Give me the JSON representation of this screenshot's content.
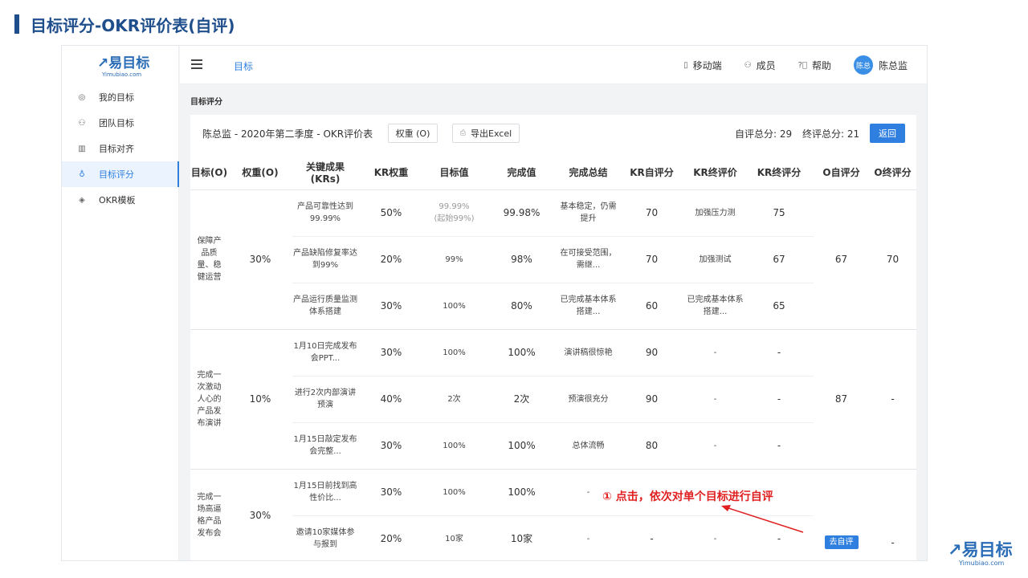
{
  "slide_title": "目标评分-OKR评价表(自评)",
  "logo": {
    "text": "易目标",
    "sub": "Yimubiao.com",
    "mark": "↗"
  },
  "sidebar": {
    "items": [
      {
        "label": "我的目标",
        "icon": "target-icon"
      },
      {
        "label": "团队目标",
        "icon": "team-icon"
      },
      {
        "label": "目标对齐",
        "icon": "book-icon"
      },
      {
        "label": "目标评分",
        "icon": "medal-icon",
        "active": true
      },
      {
        "label": "OKR模板",
        "icon": "layers-icon"
      }
    ]
  },
  "topbar": {
    "nav_label": "目标",
    "mobile": "移动端",
    "members": "成员",
    "help": "帮助",
    "avatar_text": "陈总",
    "user": "陈总监"
  },
  "section_label": "目标评分",
  "card": {
    "title": "陈总监 - 2020年第二季度 - OKR评价表",
    "weight_button": "权重 (O)",
    "export_button": "导出Excel",
    "self_total": "自评总分: 29",
    "final_total": "终评总分: 21",
    "back_button": "返回"
  },
  "table": {
    "headers": [
      "目标(O)",
      "权重(O)",
      "关键成果(KRs)",
      "KR权重",
      "目标值",
      "完成值",
      "完成总结",
      "KR自评分",
      "KR终评价",
      "KR终评分",
      "O自评分",
      "O终评分"
    ],
    "groups": [
      {
        "objective": "保障产品质量、稳健运营",
        "weight": "30%",
        "o_self": "67",
        "o_final": "70",
        "krs": [
          {
            "kr": "产品可靠性达到99.99%",
            "kr_weight": "50%",
            "target": "99.99%",
            "target_note": "(起始99%)",
            "done": "99.98%",
            "summary": "基本稳定，仍需提升",
            "self": "70",
            "final_eval": "加强压力测",
            "final_score": "75"
          },
          {
            "kr": "产品缺陷修复率达到99%",
            "kr_weight": "20%",
            "target": "99%",
            "target_note": "",
            "done": "98%",
            "summary": "在可接受范围，需继...",
            "self": "70",
            "final_eval": "加强测试",
            "final_score": "67"
          },
          {
            "kr": "产品运行质量监测体系搭建",
            "kr_weight": "30%",
            "target": "100%",
            "target_note": "",
            "done": "80%",
            "summary": "已完成基本体系搭建...",
            "self": "60",
            "final_eval": "已完成基本体系搭建...",
            "final_score": "65"
          }
        ]
      },
      {
        "objective": "完成一次激动人心的产品发布演讲",
        "weight": "10%",
        "o_self": "87",
        "o_final": "-",
        "krs": [
          {
            "kr": "1月10日完成发布会PPT...",
            "kr_weight": "30%",
            "target": "100%",
            "target_note": "",
            "done": "100%",
            "summary": "演讲稿很惊艳",
            "self": "90",
            "final_eval": "-",
            "final_score": "-"
          },
          {
            "kr": "进行2次内部演讲预演",
            "kr_weight": "40%",
            "target": "2次",
            "target_note": "",
            "done": "2次",
            "summary": "预演很充分",
            "self": "90",
            "final_eval": "-",
            "final_score": "-"
          },
          {
            "kr": "1月15日敲定发布会完整...",
            "kr_weight": "30%",
            "target": "100%",
            "target_note": "",
            "done": "100%",
            "summary": "总体流畅",
            "self": "80",
            "final_eval": "-",
            "final_score": "-"
          }
        ]
      },
      {
        "objective": "完成一场高逼格产品发布会",
        "weight": "30%",
        "o_self_button": "去自评",
        "o_final": "-",
        "krs": [
          {
            "kr": "1月15日前找到高性价比...",
            "kr_weight": "30%",
            "target": "100%",
            "target_note": "",
            "done": "100%",
            "summary": "-",
            "self": "",
            "final_eval": "",
            "final_score": ""
          },
          {
            "kr": "邀请10家媒体参与报到",
            "kr_weight": "20%",
            "target": "10家",
            "target_note": "",
            "done": "10家",
            "summary": "-",
            "self": "-",
            "final_eval": "-",
            "final_score": "-"
          }
        ]
      }
    ]
  },
  "annotation": "① 点击，依次对单个目标进行自评",
  "colors": {
    "brand": "#1f4e8c",
    "accent": "#2f7fe0",
    "annotation": "#e02020"
  }
}
